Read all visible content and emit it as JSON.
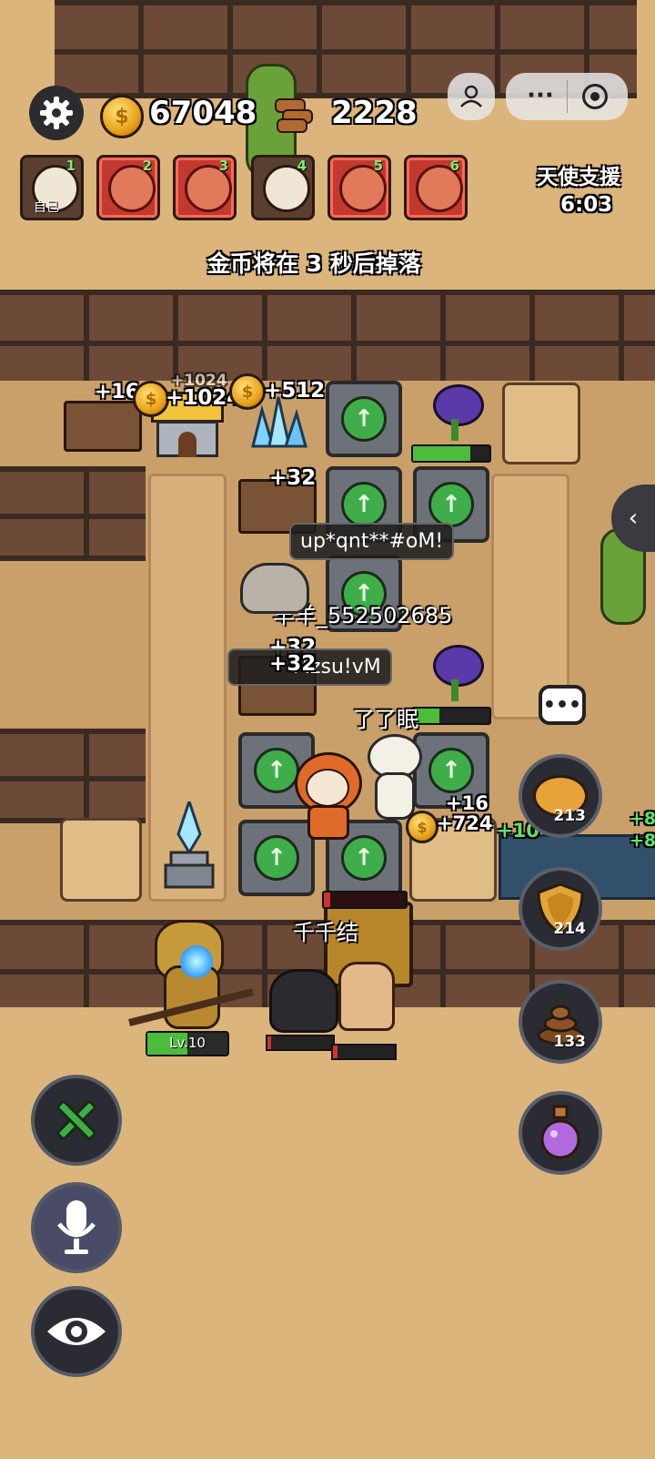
{
  "hud": {
    "coins": "67048",
    "wood": "2228",
    "gear_icon": "gear-icon",
    "coin_icon": "coin-icon",
    "wood_icon": "wood-logs-icon"
  },
  "players": [
    {
      "num": "1",
      "label": "自己",
      "state": "normal"
    },
    {
      "num": "2",
      "label": "",
      "state": "attacked"
    },
    {
      "num": "3",
      "label": "",
      "state": "attacked"
    },
    {
      "num": "4",
      "label": "",
      "state": "normal"
    },
    {
      "num": "5",
      "label": "",
      "state": "attacked"
    },
    {
      "num": "6",
      "label": "",
      "state": "attacked"
    }
  ],
  "support": {
    "title": "天使支援",
    "timer": "6:03"
  },
  "notice": "金币将在 3 秒后掉落",
  "floaters": {
    "wood_left": "+16",
    "coin_house": "+1024",
    "coin_house_top": "+1024",
    "crystal": "+512",
    "wood_mid": "+32",
    "wood_low1": "+32",
    "wood_low2": "+32",
    "wood_right": "+16",
    "coin_right": "+724",
    "right_edge1": "+10",
    "right_edge2": "+8",
    "right_edge3": "+8"
  },
  "chat": {
    "bubble1": "up*qnt**#oM!",
    "bubble2": "Mzsu!vM"
  },
  "names": {
    "player_a": "羊羊_552502685",
    "player_b": "了了眠",
    "player_c": "千千结"
  },
  "enemy": {
    "level": "Lv.10"
  },
  "plant_hp": [
    0.75,
    0.35
  ],
  "right_buttons": [
    {
      "name": "piggy-bank",
      "count": "213"
    },
    {
      "name": "shield",
      "count": "214"
    },
    {
      "name": "poop",
      "count": "133"
    },
    {
      "name": "potion",
      "count": ""
    }
  ],
  "colors": {
    "accent_green": "#3fae4a",
    "attack_red": "#c23a2f",
    "coin_gold": "#e8a21a"
  }
}
